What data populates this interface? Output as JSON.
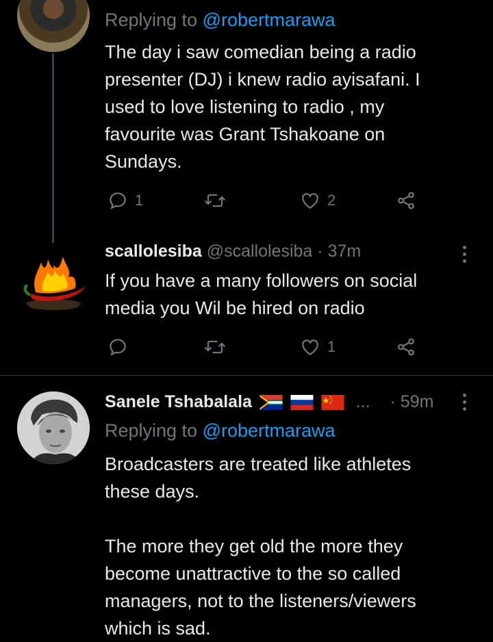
{
  "tweet1": {
    "replying_prefix": "Replying to ",
    "replying_handle": "@robertmarawa",
    "text_lines": [
      "The day i saw comedian being a radio",
      "presenter (DJ) i knew radio ayisafani. I",
      "used to love listening to radio , my",
      "favourite was Grant Tshakoane on",
      "Sundays."
    ],
    "reply_count": "1",
    "like_count": "2"
  },
  "tweet2": {
    "display_name": "scallolesiba",
    "handle": "@scallolesiba",
    "time": "· 37m",
    "text_lines": [
      "If you have a many followers on social",
      "media you Wil be hired on radio"
    ],
    "like_count": "1"
  },
  "tweet3": {
    "display_name": "Sanele Tshabalala",
    "ellipsis": "...",
    "time": "· 59m",
    "replying_prefix": "Replying to ",
    "replying_handle": "@robertmarawa",
    "text_lines": [
      "Broadcasters are treated like athletes",
      "these days.",
      "",
      "The more they get old the more they",
      "become unattractive to the so called",
      "managers, not to the listeners/viewers",
      "which is sad."
    ]
  },
  "icons": {
    "reply": "reply-icon",
    "retweet": "retweet-icon",
    "like": "heart-icon",
    "share": "share-icon",
    "more": "more-vertical-icon"
  },
  "colors": {
    "background": "#000000",
    "text": "#e7e9ea",
    "muted": "#71767b",
    "link": "#1d9bf0",
    "divider": "#2f3336"
  }
}
